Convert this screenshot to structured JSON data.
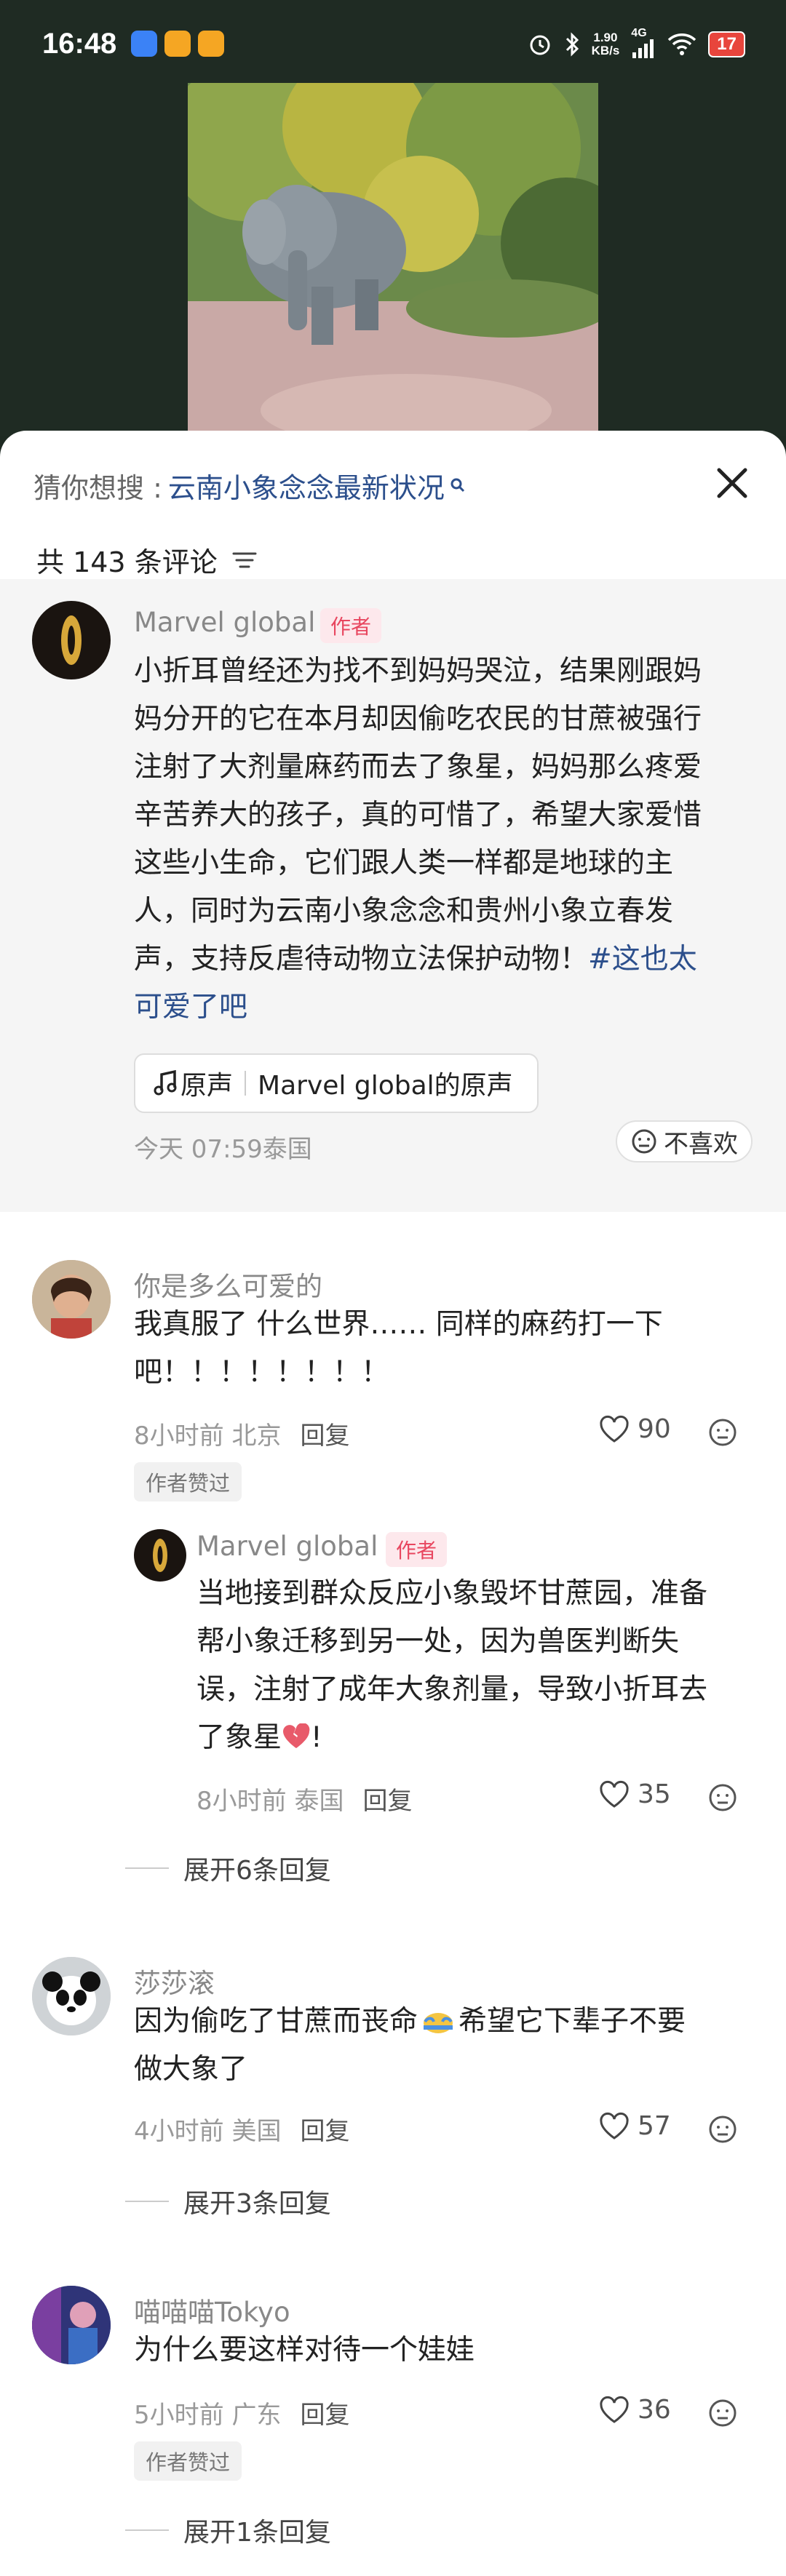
{
  "status": {
    "time": "16:48",
    "speed_top": "1.90",
    "speed_bottom": "KB/s",
    "net": "4G",
    "battery": "17"
  },
  "search": {
    "label": "猜你想搜 :",
    "query": "云南小象念念最新状况"
  },
  "comments_header": {
    "count_label": "共 143 条评论"
  },
  "author_post": {
    "username": "Marvel global",
    "tag": "作者",
    "lines": [
      "小折耳曾经还为找不到妈妈哭泣，结果刚跟妈",
      "妈分开的它在本月却因偷吃农民的甘蔗被强行",
      "注射了大剂量麻药而去了象星，妈妈那么疼爱",
      "辛苦养大的孩子，真的可惜了，希望大家爱惜",
      "这些小生命，它们跟人类一样都是地球的主",
      "人，同时为云南小象念念和贵州小象立春发",
      "声，支持反虐待动物立法保护动物！"
    ],
    "hashtag_1": "#这也太",
    "hashtag_2": "可爱了吧",
    "sound_label": "原声",
    "sound_source": "Marvel global的原声",
    "meta": "今天 07:59泰国",
    "dislike": "不喜欢"
  },
  "comments": [
    {
      "username": "你是多么可爱的",
      "line1": "我真服了 什么世界……  同样的麻药打一下",
      "line2": "吧！！！！！！！！",
      "meta": "8小时前 北京",
      "reply": "回复",
      "likes": "90",
      "badge": "作者赞过"
    },
    {
      "username": "Marvel global",
      "tag": "作者",
      "line1": "当地接到群众反应小象毁坏甘蔗园，准备",
      "line2": "帮小象迁移到另一处，因为兽医判断失",
      "line3": "误，注射了成年大象剂量，导致小折耳去",
      "line4": "了象星",
      "line4_end": "!",
      "meta": "8小时前 泰国",
      "reply": "回复",
      "likes": "35"
    },
    {
      "expand": "展开6条回复"
    },
    {
      "username": "莎莎滚",
      "line1a": "因为偷吃了甘蔗而丧命",
      "line1b": "希望它下辈子不要",
      "line2": "做大象了",
      "meta": "4小时前 美国",
      "reply": "回复",
      "likes": "57",
      "expand": "展开3条回复"
    },
    {
      "username": "喵喵喵Tokyo",
      "line1": "为什么要这样对待一个娃娃",
      "meta": "5小时前 广东",
      "reply": "回复",
      "likes": "36",
      "badge": "作者赞过",
      "expand": "展开1条回复"
    }
  ],
  "colors": {
    "link": "#2c4f8c",
    "author_tag_bg": "#fde8ec",
    "author_tag_text": "#e8465f",
    "author_block_bg": "#f5f5f5"
  }
}
